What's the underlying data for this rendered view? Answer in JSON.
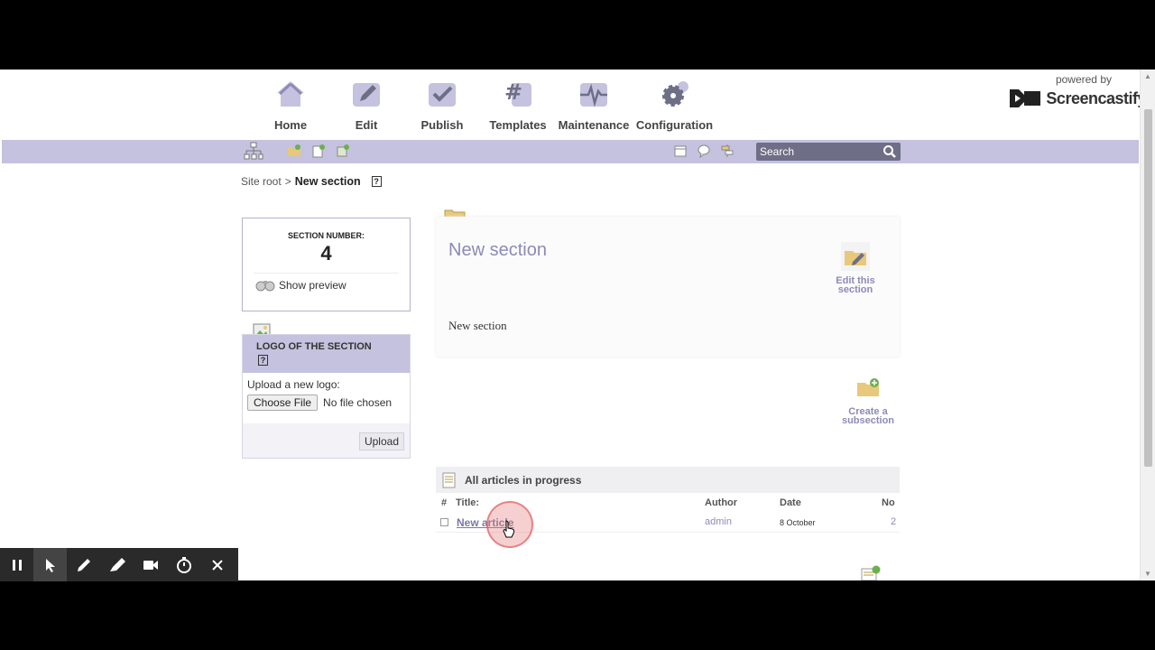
{
  "nav": {
    "items": [
      {
        "label": "Home",
        "icon": "home-icon"
      },
      {
        "label": "Edit",
        "icon": "pencil-icon"
      },
      {
        "label": "Publish",
        "icon": "check-icon"
      },
      {
        "label": "Templates",
        "icon": "hash-icon"
      },
      {
        "label": "Maintenance",
        "icon": "pulse-icon"
      },
      {
        "label": "Configuration",
        "icon": "gear-icon"
      }
    ]
  },
  "watermark": {
    "powered": "powered by",
    "brand": "Screencastify"
  },
  "search": {
    "placeholder": "Search"
  },
  "breadcrumb": {
    "root": "Site root",
    "sep": ">",
    "current": "New section",
    "help": "?"
  },
  "section": {
    "number_label": "SECTION NUMBER:",
    "number": "4",
    "preview": "Show preview"
  },
  "logo": {
    "title": "LOGO OF THE SECTION",
    "help": "?",
    "upload_label": "Upload a new logo:",
    "choose": "Choose File",
    "no_file": "No file chosen",
    "upload": "Upload"
  },
  "main": {
    "title": "New section",
    "description": "New section",
    "edit_line1": "Edit this",
    "edit_line2": "section",
    "create_line1": "Create a",
    "create_line2": "subsection"
  },
  "articles": {
    "header": "All articles in progress",
    "columns": {
      "hash": "#",
      "title": "Title:",
      "author": "Author",
      "date": "Date",
      "no": "No"
    },
    "rows": [
      {
        "title": "New article",
        "author": "admin",
        "date": "8 October",
        "no": "2"
      }
    ]
  },
  "colors": {
    "accent": "#8d8ab8",
    "toolbar": "#c4c2de"
  }
}
